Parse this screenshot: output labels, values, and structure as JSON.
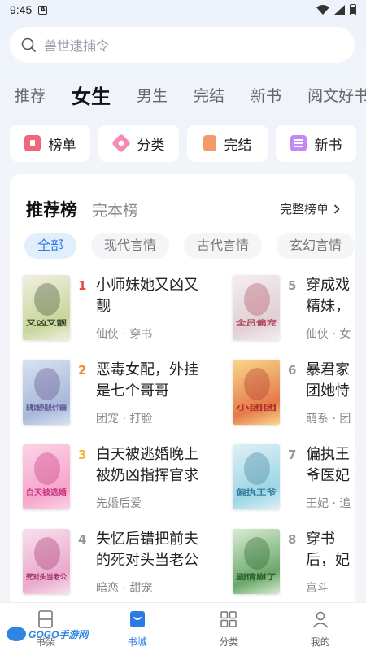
{
  "status": {
    "time": "9:45",
    "a_label": "A"
  },
  "search": {
    "placeholder": "兽世逮捕令"
  },
  "channel_tabs": [
    "推荐",
    "女生",
    "男生",
    "完结",
    "新书",
    "阅文好书"
  ],
  "active_channel": 1,
  "quick_entries": [
    {
      "label": "榜单",
      "icon": "ranking-icon"
    },
    {
      "label": "分类",
      "icon": "category-icon"
    },
    {
      "label": "完结",
      "icon": "finished-icon"
    },
    {
      "label": "新书",
      "icon": "new-book-icon"
    }
  ],
  "ranking": {
    "tab_active": "推荐榜",
    "tab_other": "完本榜",
    "full_list": "完整榜单",
    "filters": [
      "全部",
      "现代言情",
      "古代言情",
      "玄幻言情"
    ],
    "books": [
      {
        "rank": "1",
        "title": "小师妹她又凶又靓",
        "tags": "仙侠 · 穿书",
        "cover_text": "又凶又靓",
        "colors": [
          "#f2efe2",
          "#c8d69a",
          "#3b4a2a"
        ]
      },
      {
        "rank": "2",
        "title": "恶毒女配，外挂是七个哥哥",
        "tags": "团宠 · 打脸",
        "cover_text": "恶毒女配外挂是七个哥哥",
        "colors": [
          "#d8e2f1",
          "#a7b8d9",
          "#5b4b8a"
        ]
      },
      {
        "rank": "3",
        "title": "白天被逃婚晚上被奶凶指挥官求",
        "tags": "先婚后爱",
        "cover_text": "白天被逃婚",
        "colors": [
          "#fbd3e6",
          "#f7a6cc",
          "#c2307a"
        ]
      },
      {
        "rank": "4",
        "title": "失忆后错把前夫的死对头当老公",
        "tags": "暗恋 · 甜宠",
        "cover_text": "死对头当老公",
        "colors": [
          "#f7e0ef",
          "#eaa9cb",
          "#a0306b"
        ]
      },
      {
        "rank": "5",
        "title": "穿成戏精妹，全是",
        "tags": "仙侠 · 女",
        "cover_text": "全员偏宠",
        "colors": [
          "#f4eef0",
          "#e1d0d6",
          "#b04a5a"
        ]
      },
      {
        "rank": "6",
        "title": "暴君家团她恃宠",
        "tags": "萌系 · 团",
        "cover_text": "小团团",
        "colors": [
          "#f9d88a",
          "#e57a4a",
          "#b2302a"
        ]
      },
      {
        "rank": "7",
        "title": "偏执王爷医妃",
        "tags": "王妃 · 追",
        "cover_text": "偏执王爷",
        "colors": [
          "#dff0f5",
          "#9dd6e6",
          "#3a7e9c"
        ]
      },
      {
        "rank": "8",
        "title": "穿书后，妃又剧",
        "tags": "宫斗",
        "cover_text": "剧情崩了",
        "colors": [
          "#d8ecd3",
          "#6aa86a",
          "#2c5e2e"
        ]
      }
    ],
    "rank_colors": [
      "#e84a4a",
      "#f08a2c",
      "#f4b63a",
      "#999999",
      "#999999",
      "#999999",
      "#999999",
      "#999999"
    ]
  },
  "bottom_nav": [
    {
      "label": "书架",
      "icon": "bookshelf-icon"
    },
    {
      "label": "书城",
      "icon": "bookstore-icon"
    },
    {
      "label": "分类",
      "icon": "grid-icon"
    },
    {
      "label": "我的",
      "icon": "profile-icon"
    }
  ],
  "active_nav": 1,
  "watermark": "GOGO手游网",
  "accent": "#2c7be5"
}
